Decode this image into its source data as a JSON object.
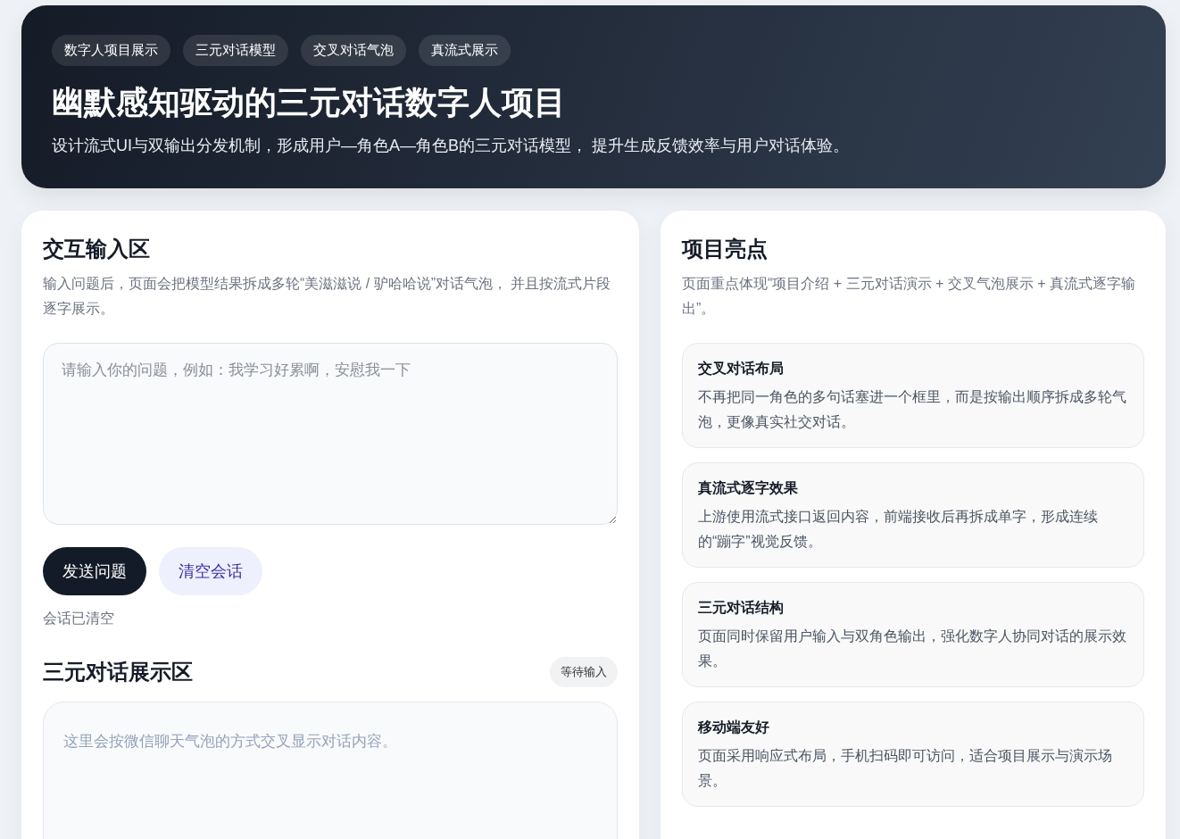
{
  "hero": {
    "tags": [
      "数字人项目展示",
      "三元对话模型",
      "交叉对话气泡",
      "真流式展示"
    ],
    "title": "幽默感知驱动的三元对话数字人项目",
    "subtitle": "设计流式UI与双输出分发机制，形成用户—角色A—角色B的三元对话模型， 提升生成反馈效率与用户对话体验。"
  },
  "input_panel": {
    "title": "交互输入区",
    "description": "输入问题后，页面会把模型结果拆成多轮“美滋滋说 / 驴哈哈说”对话气泡， 并且按流式片段逐字展示。",
    "question_field": {
      "placeholder": "请输入你的问题，例如：我学习好累啊，安慰我一下"
    },
    "buttons": [
      {
        "label": "发送问题",
        "kind": "primary"
      },
      {
        "label": "清空会话",
        "kind": "secondary"
      }
    ],
    "status": "会话已清空"
  },
  "dialogue_panel": {
    "title": "三元对话展示区",
    "status_badge": "等待输入",
    "empty_message": "这里会按微信聊天气泡的方式交叉显示对话内容。"
  },
  "highlights": {
    "title": "项目亮点",
    "description": "页面重点体现“项目介绍 + 三元对话演示 + 交叉气泡展示 + 真流式逐字输出”。",
    "items": [
      {
        "title": "交叉对话布局",
        "text": "不再把同一角色的多句话塞进一个框里，而是按输出顺序拆成多轮气泡，更像真实社交对话。"
      },
      {
        "title": "真流式逐字效果",
        "text": "上游使用流式接口返回内容，前端接收后再拆成单字，形成连续的“蹦字”视觉反馈。"
      },
      {
        "title": "三元对话结构",
        "text": "页面同时保留用户输入与双角色输出，强化数字人协同对话的展示效果。"
      },
      {
        "title": "移动端友好",
        "text": "页面采用响应式布局，手机扫码即可访问，适合项目展示与演示场景。"
      }
    ]
  }
}
